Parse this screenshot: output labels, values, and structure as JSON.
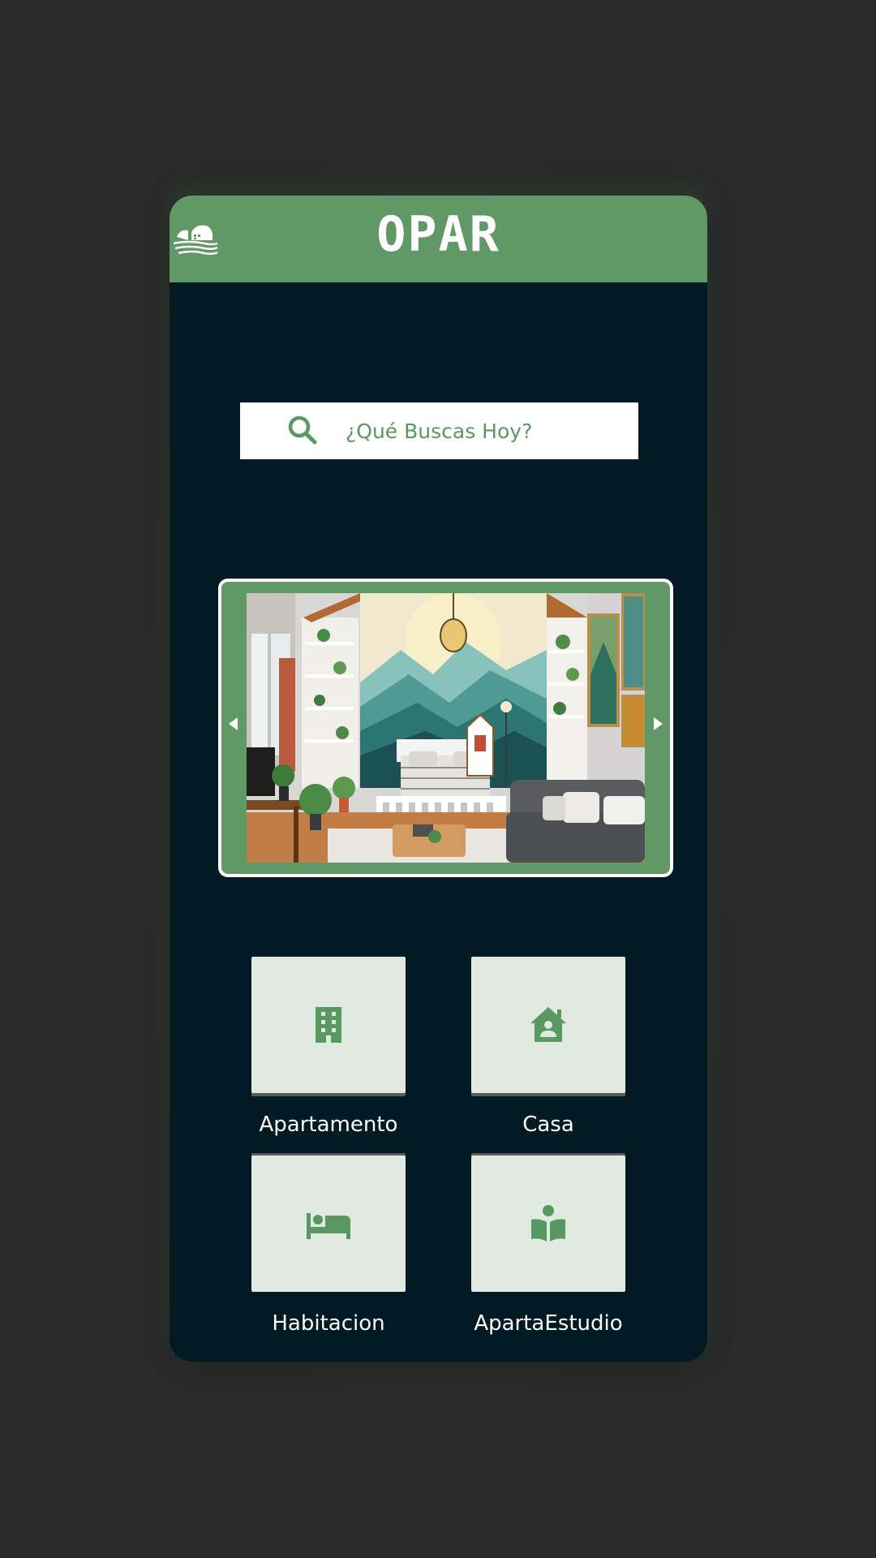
{
  "header": {
    "app_title": "OPAR",
    "logo_icon": "house-landscape-logo"
  },
  "search": {
    "placeholder": "¿Qué Buscas Hoy?",
    "icon": "search-icon"
  },
  "carousel": {
    "image_subject": "bedroom-living-room-interior",
    "prev_icon": "chevron-left-icon",
    "next_icon": "chevron-right-icon"
  },
  "categories": [
    {
      "label": "Apartamento",
      "icon": "building-icon"
    },
    {
      "label": "Casa",
      "icon": "house-person-icon"
    },
    {
      "label": "Habitacion",
      "icon": "bed-icon"
    },
    {
      "label": "ApartaEstudio",
      "icon": "person-reading-icon"
    }
  ],
  "colors": {
    "brand_green": "#609965",
    "screen_background": "#021a24",
    "tile_background": "#e0eae1",
    "page_background": "#2b2b2b"
  }
}
